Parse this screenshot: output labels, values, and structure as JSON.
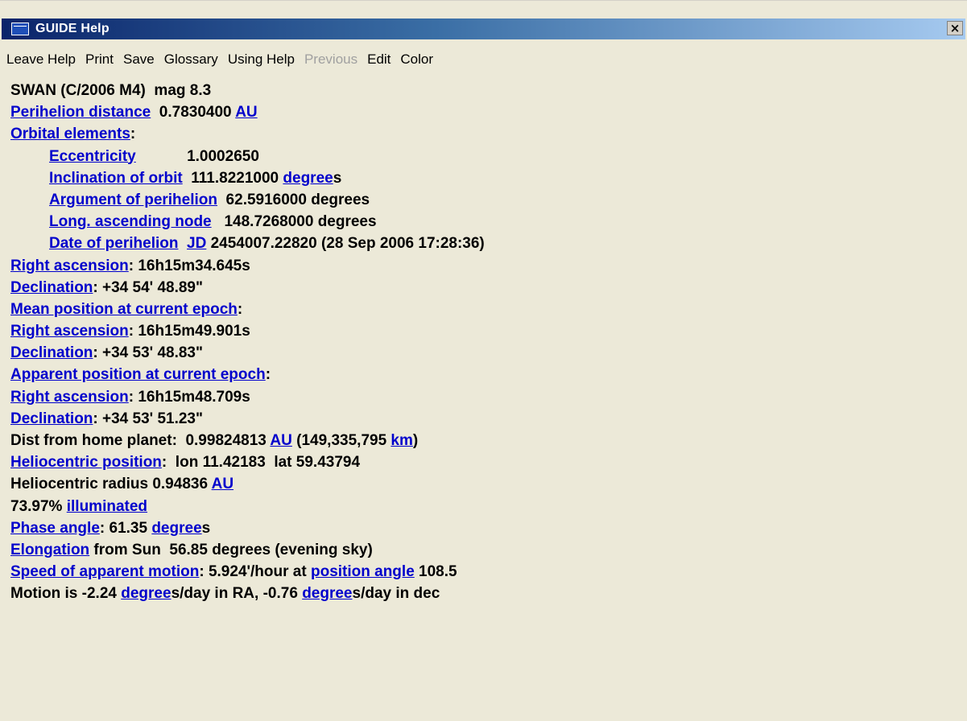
{
  "window": {
    "title": "GUIDE Help",
    "close_label": "×"
  },
  "menu": {
    "leave_help": "Leave Help",
    "print": "Print",
    "save": "Save",
    "glossary": "Glossary",
    "using_help": "Using Help",
    "previous": "Previous",
    "edit": "Edit",
    "color": "Color"
  },
  "content": {
    "title": "SWAN (C/2006 M4)  mag 8.3",
    "perihelion": {
      "label": "Perihelion distance",
      "value": "  0.7830400 ",
      "unit": "AU"
    },
    "orbital": {
      "label": "Orbital elements",
      "suffix": ":"
    },
    "eccentricity": {
      "label": "Eccentricity",
      "value": "            1.0002650"
    },
    "inclination": {
      "label": "Inclination of orbit",
      "value": "  111.8221000 ",
      "unit": "degree",
      "unit_suffix": "s"
    },
    "arg_perihelion": {
      "label": "Argument of perihelion",
      "value": "  62.5916000 degrees"
    },
    "long_node": {
      "label": "Long. ascending node",
      "value": "   148.7268000 degrees"
    },
    "date_perihelion": {
      "label": "Date of perihelion",
      "gap": "  ",
      "jd": "JD",
      "value": " 2454007.22820 (28 Sep 2006 17:28:36)"
    },
    "ra1": {
      "label": "Right ascension",
      "value": ": 16h15m34.645s"
    },
    "dec1": {
      "label": "Declination",
      "value": ": +34 54' 48.89\""
    },
    "mean_pos": {
      "label": "Mean position at current epoch",
      "suffix": ":"
    },
    "ra2": {
      "label": "Right ascension",
      "value": ": 16h15m49.901s"
    },
    "dec2": {
      "label": "Declination",
      "value": ": +34 53' 48.83\""
    },
    "apparent_pos": {
      "label": "Apparent position at current epoch",
      "suffix": ":"
    },
    "ra3": {
      "label": "Right ascension",
      "value": ": 16h15m48.709s"
    },
    "dec3": {
      "label": "Declination",
      "value": ": +34 53' 51.23\""
    },
    "dist": {
      "prefix": "Dist from home planet:  0.99824813 ",
      "au": "AU",
      "middle": " (149,335,795 ",
      "km": "km",
      "suffix": ")"
    },
    "helio_pos": {
      "label": "Heliocentric position",
      "value": ":  lon 11.42183  lat 59.43794"
    },
    "helio_radius": {
      "prefix": "Heliocentric radius 0.94836 ",
      "unit": "AU"
    },
    "illum": {
      "prefix": "73.97% ",
      "label": "illuminated"
    },
    "phase": {
      "label": "Phase angle",
      "value": ": 61.35 ",
      "unit": "degree",
      "unit_suffix": "s"
    },
    "elong": {
      "label": "Elongation",
      "value": " from Sun  56.85 degrees (evening sky)"
    },
    "speed": {
      "label": "Speed of apparent motion",
      "value": ": 5.924'/hour at ",
      "pa": "position angle",
      "pa_value": " 108.5"
    },
    "motion": {
      "prefix": "Motion is -2.24 ",
      "unit1": "degree",
      "mid": "s/day in RA, -0.76 ",
      "unit2": "degree",
      "suffix": "s/day in dec"
    }
  }
}
